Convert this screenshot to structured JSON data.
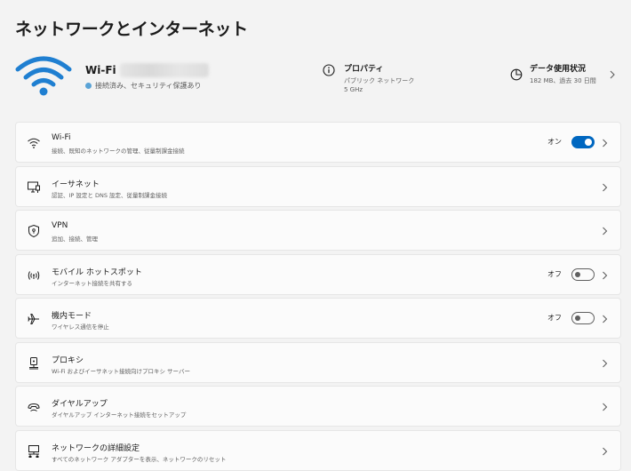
{
  "page": {
    "title": "ネットワークとインターネット"
  },
  "connection": {
    "name": "Wi-Fi",
    "status": "接続済み、セキュリティ保護あり"
  },
  "properties": {
    "title": "プロパティ",
    "line1": "パブリック ネットワーク",
    "line2": "5 GHz"
  },
  "data_usage": {
    "title": "データ使用状況",
    "detail": "182 MB、過去 30 日間"
  },
  "colors": {
    "accent": "#0067c0",
    "wifi_icon": "#1f7fd1",
    "status_dot": "#5aa3d6"
  },
  "items": [
    {
      "icon": "wifi-icon",
      "title": "Wi-Fi",
      "subtitle": "接続、既知のネットワークの管理、従量制課金接続",
      "state": "オン",
      "toggle": "on"
    },
    {
      "icon": "ethernet-icon",
      "title": "イーサネット",
      "subtitle": "認証、IP 設定と DNS 設定、従量制課金接続"
    },
    {
      "icon": "vpn-shield-icon",
      "title": "VPN",
      "subtitle": "追加、接続、管理"
    },
    {
      "icon": "mobile-hotspot-icon",
      "title": "モバイル ホットスポット",
      "subtitle": "インターネット接続を共有する",
      "state": "オフ",
      "toggle": "off"
    },
    {
      "icon": "airplane-icon",
      "title": "機内モード",
      "subtitle": "ワイヤレス通信を停止",
      "state": "オフ",
      "toggle": "off"
    },
    {
      "icon": "proxy-icon",
      "title": "プロキシ",
      "subtitle": "Wi-Fi およびイーサネット接続向けプロキシ サーバー"
    },
    {
      "icon": "dialup-icon",
      "title": "ダイヤルアップ",
      "subtitle": "ダイヤルアップ インターネット接続をセットアップ"
    },
    {
      "icon": "advanced-network-icon",
      "title": "ネットワークの詳細設定",
      "subtitle": "すべてのネットワーク アダプターを表示、ネットワークのリセット"
    }
  ]
}
